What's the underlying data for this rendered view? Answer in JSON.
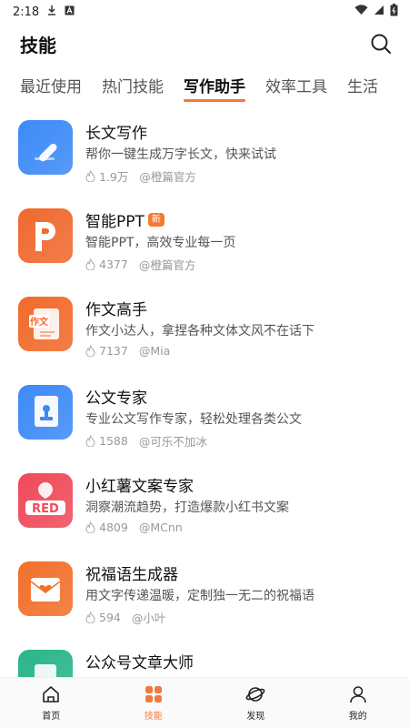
{
  "status": {
    "time": "2:18"
  },
  "header": {
    "title": "技能"
  },
  "tabs": [
    {
      "label": "最近使用"
    },
    {
      "label": "热门技能"
    },
    {
      "label": "写作助手"
    },
    {
      "label": "效率工具"
    },
    {
      "label": "生活"
    }
  ],
  "active_tab": "写作助手",
  "items": [
    {
      "name": "长文写作",
      "badge": "",
      "desc": "帮你一键生成万字长文，快来试试",
      "count": "1.9万",
      "author": "@橙篇官方",
      "icon": "pen-icon",
      "color": "#3d8af7"
    },
    {
      "name": "智能PPT",
      "badge": "新",
      "desc": "智能PPT，高效专业每一页",
      "count": "4377",
      "author": "@橙篇官方",
      "icon": "ppt-icon",
      "color": "#f0692f"
    },
    {
      "name": "作文高手",
      "badge": "",
      "desc": "作文小达人，拿捏各种文体文风不在话下",
      "count": "7137",
      "author": "@Mia",
      "icon": "essay-icon",
      "color": "#f26a2b"
    },
    {
      "name": "公文专家",
      "badge": "",
      "desc": "专业公文写作专家，轻松处理各类公文",
      "count": "1588",
      "author": "@可乐不加冰",
      "icon": "document-icon",
      "color": "#3d8af7"
    },
    {
      "name": "小红薯文案专家",
      "badge": "",
      "desc": "洞察潮流趋势，打造爆款小红书文案",
      "count": "4809",
      "author": "@MCnn",
      "icon": "red-icon",
      "color": "#f04a5a",
      "icon_text": "RED"
    },
    {
      "name": "祝福语生成器",
      "badge": "",
      "desc": "用文字传递温暖，定制独一无二的祝福语",
      "count": "594",
      "author": "@小叶",
      "icon": "heart-envelope-icon",
      "color": "#f2702c"
    },
    {
      "name": "公众号文章大师",
      "badge": "",
      "desc": "",
      "count": "",
      "author": "",
      "icon": "article-icon",
      "color": "#2ab58a"
    }
  ],
  "nav": [
    {
      "label": "首页",
      "icon": "home-icon"
    },
    {
      "label": "技能",
      "icon": "skills-grid-icon"
    },
    {
      "label": "发现",
      "icon": "planet-icon"
    },
    {
      "label": "我的",
      "icon": "profile-icon"
    }
  ],
  "colors": {
    "accent": "#f07a3b"
  }
}
